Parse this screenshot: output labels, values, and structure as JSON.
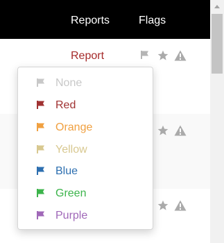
{
  "header": {
    "reports_label": "Reports",
    "flags_label": "Flags"
  },
  "rows": [
    {
      "report_label": "Report"
    },
    {
      "report_label": ""
    },
    {
      "report_label": ""
    }
  ],
  "row_icons": [
    "flag-icon",
    "star-icon",
    "warning-icon"
  ],
  "colors": {
    "header_bg": "#000000",
    "report_link": "#a52a2a",
    "icon_gray": "#aaaaaa"
  },
  "flag_menu": {
    "options": [
      {
        "label": "None",
        "color": "#c8c8c8"
      },
      {
        "label": "Red",
        "color": "#a03232"
      },
      {
        "label": "Orange",
        "color": "#f0a040"
      },
      {
        "label": "Yellow",
        "color": "#d8c890"
      },
      {
        "label": "Blue",
        "color": "#2d6fb0"
      },
      {
        "label": "Green",
        "color": "#3cb44b"
      },
      {
        "label": "Purple",
        "color": "#a068b8"
      }
    ]
  }
}
